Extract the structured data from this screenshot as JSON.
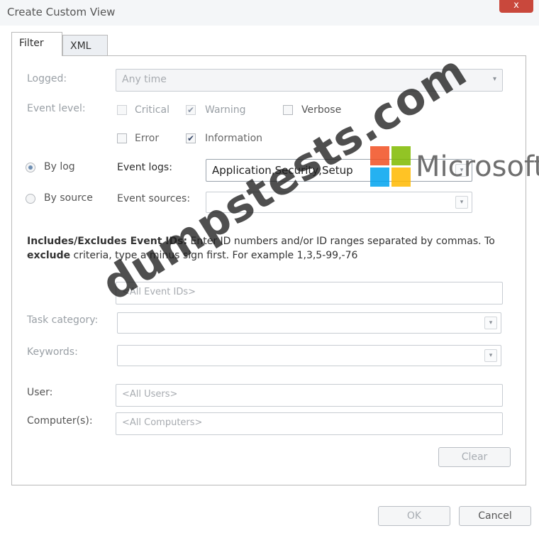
{
  "window": {
    "title": "Create Custom View",
    "close_glyph": "x"
  },
  "tabs": [
    {
      "label": "Filter",
      "active": true
    },
    {
      "label": "XML",
      "active": false
    }
  ],
  "filter": {
    "logged": {
      "label": "Logged:",
      "value": "Any time"
    },
    "event_level": {
      "label": "Event level:",
      "options": [
        {
          "label": "Critical",
          "checked": false
        },
        {
          "label": "Warning",
          "checked": true
        },
        {
          "label": "Verbose",
          "checked": false
        },
        {
          "label": "Error",
          "checked": false
        },
        {
          "label": "Information",
          "checked": true
        }
      ],
      "check_glyph": "✔"
    },
    "by_log": {
      "label": "By log",
      "selected": true
    },
    "by_source": {
      "label": "By source",
      "selected": false
    },
    "event_logs": {
      "label": "Event logs:",
      "value": "Application,Security,Setup"
    },
    "event_sources": {
      "label": "Event sources:",
      "value": ""
    },
    "description": {
      "bold1": "Includes/Excludes Event IDs:",
      "text1": " Enter ID numbers and/or ID ranges separated by commas. To ",
      "bold2": "exclude",
      "text2": " criteria, type a minus sign first. For example 1,3,5-99,-76"
    },
    "event_ids_placeholder": "<All Event IDs>",
    "task_category": {
      "label": "Task category:",
      "value": ""
    },
    "keywords": {
      "label": "Keywords:",
      "value": ""
    },
    "user": {
      "label": "User:",
      "value": "<All Users>"
    },
    "computers": {
      "label": "Computer(s):",
      "value": "<All Computers>"
    },
    "clear_label": "Clear"
  },
  "footer": {
    "ok_label": "OK",
    "cancel_label": "Cancel"
  },
  "overlays": {
    "logo_text": "Microsoft",
    "watermark": "dumpstests.com"
  },
  "icons": {
    "dropdown_arrow": "▾"
  },
  "colors": {
    "ms_red": "#f25022",
    "ms_green": "#7fba00",
    "ms_blue": "#00a4ef",
    "ms_yellow": "#ffb900"
  }
}
